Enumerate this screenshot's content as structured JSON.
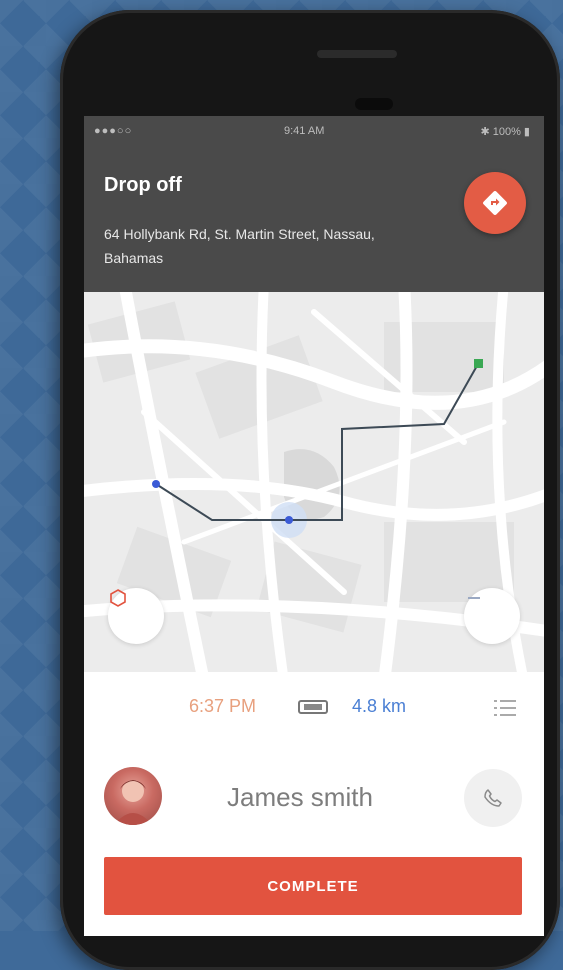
{
  "status_bar": {
    "carrier": "●●●○○",
    "wifi_icon": "wifi-icon",
    "time": "9:41 AM",
    "battery": "✱ 100% ▮"
  },
  "header": {
    "title": "Drop off",
    "address": "64 Hollybank Rd, St. Martin Street, Nassau, Bahamas",
    "nav_icon": "directions-icon"
  },
  "trip": {
    "eta": "6:37 PM",
    "distance": "4.8 km"
  },
  "driver": {
    "name": "James smith"
  },
  "actions": {
    "complete_label": "COMPLETE"
  },
  "colors": {
    "accent": "#e2533f",
    "header_bg": "#4a4a4a",
    "distance": "#4a7fd4",
    "eta": "#e8a07e"
  }
}
